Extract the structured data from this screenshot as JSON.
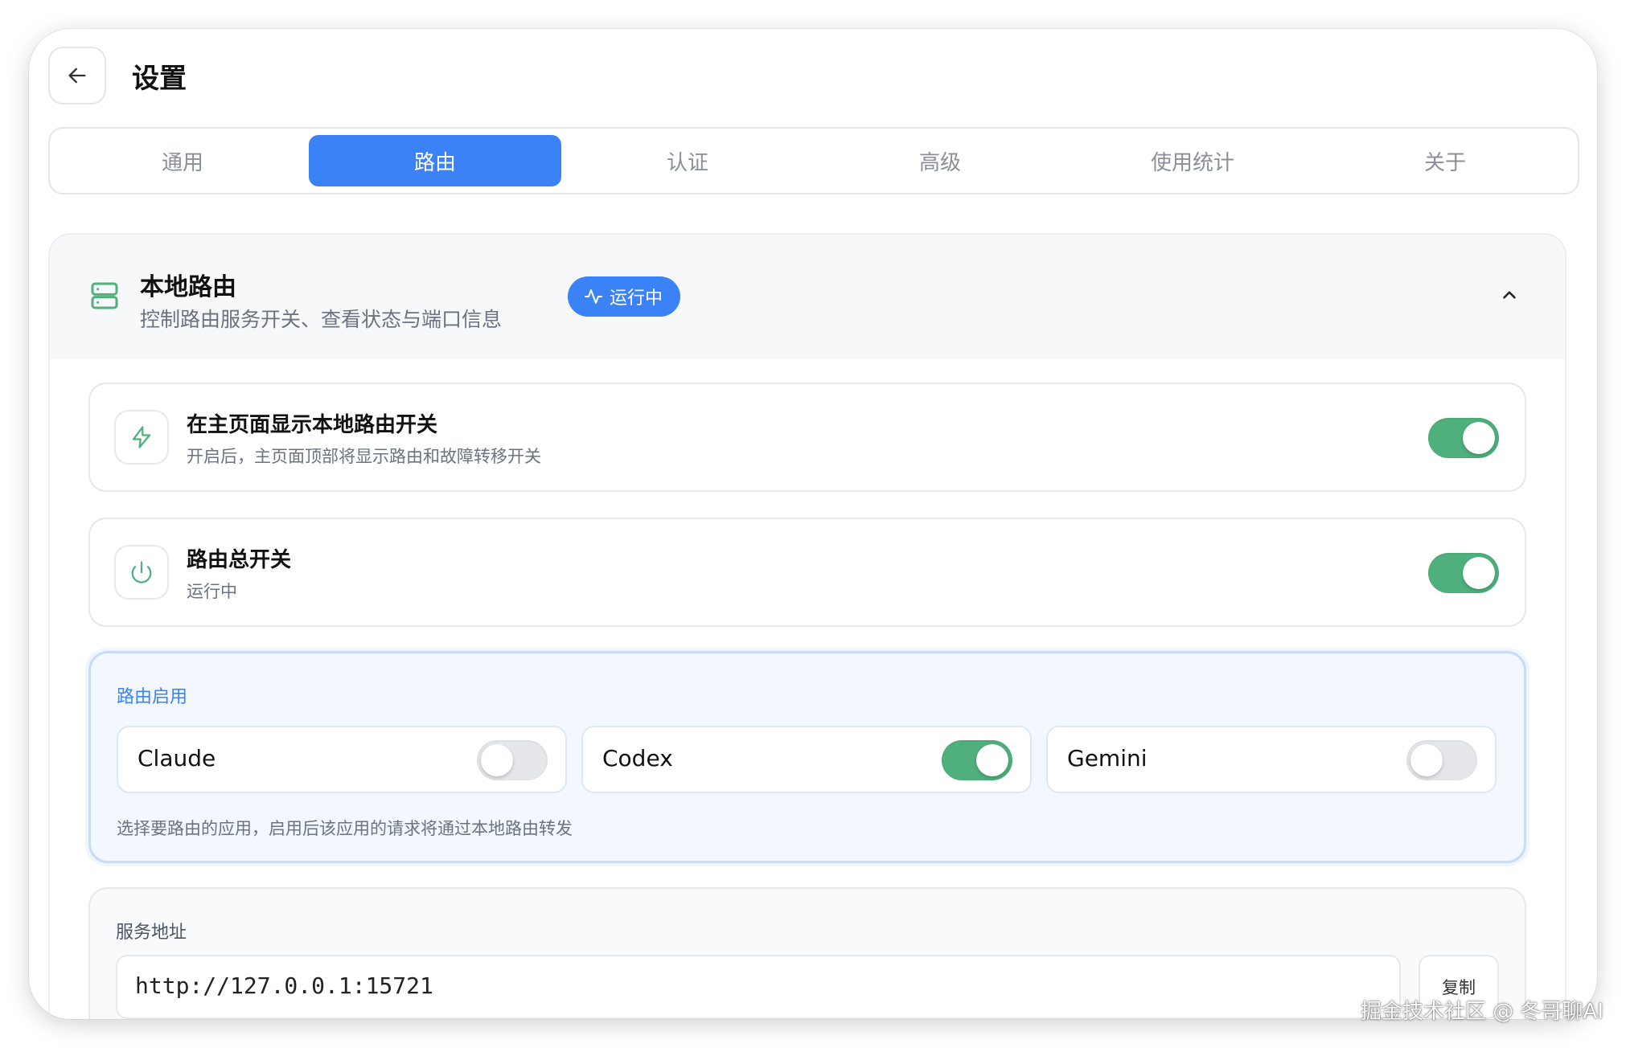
{
  "header": {
    "title": "设置"
  },
  "tabs": [
    {
      "label": "通用"
    },
    {
      "label": "路由"
    },
    {
      "label": "认证"
    },
    {
      "label": "高级"
    },
    {
      "label": "使用统计"
    },
    {
      "label": "关于"
    }
  ],
  "active_tab": "路由",
  "section": {
    "title": "本地路由",
    "subtitle": "控制路由服务开关、查看状态与端口信息",
    "status_badge": "运行中"
  },
  "settings": {
    "show_toggle": {
      "title": "在主页面显示本地路由开关",
      "desc": "开启后，主页面顶部将显示路由和故障转移开关",
      "enabled": true
    },
    "master_switch": {
      "title": "路由总开关",
      "desc": "运行中",
      "enabled": true
    }
  },
  "routing_apps": {
    "label": "路由启用",
    "apps": [
      {
        "name": "Claude",
        "enabled": false
      },
      {
        "name": "Codex",
        "enabled": true
      },
      {
        "name": "Gemini",
        "enabled": false
      }
    ],
    "hint": "选择要路由的应用，启用后该应用的请求将通过本地路由转发"
  },
  "service_address": {
    "label": "服务地址",
    "value": "http://127.0.0.1:15721",
    "copy_label": "复制"
  },
  "colors": {
    "accent": "#3b82f6",
    "toggle_on": "#4fb07d",
    "icon_green": "#4fb07d"
  },
  "watermark": "掘金技术社区 @ 冬哥聊AI"
}
